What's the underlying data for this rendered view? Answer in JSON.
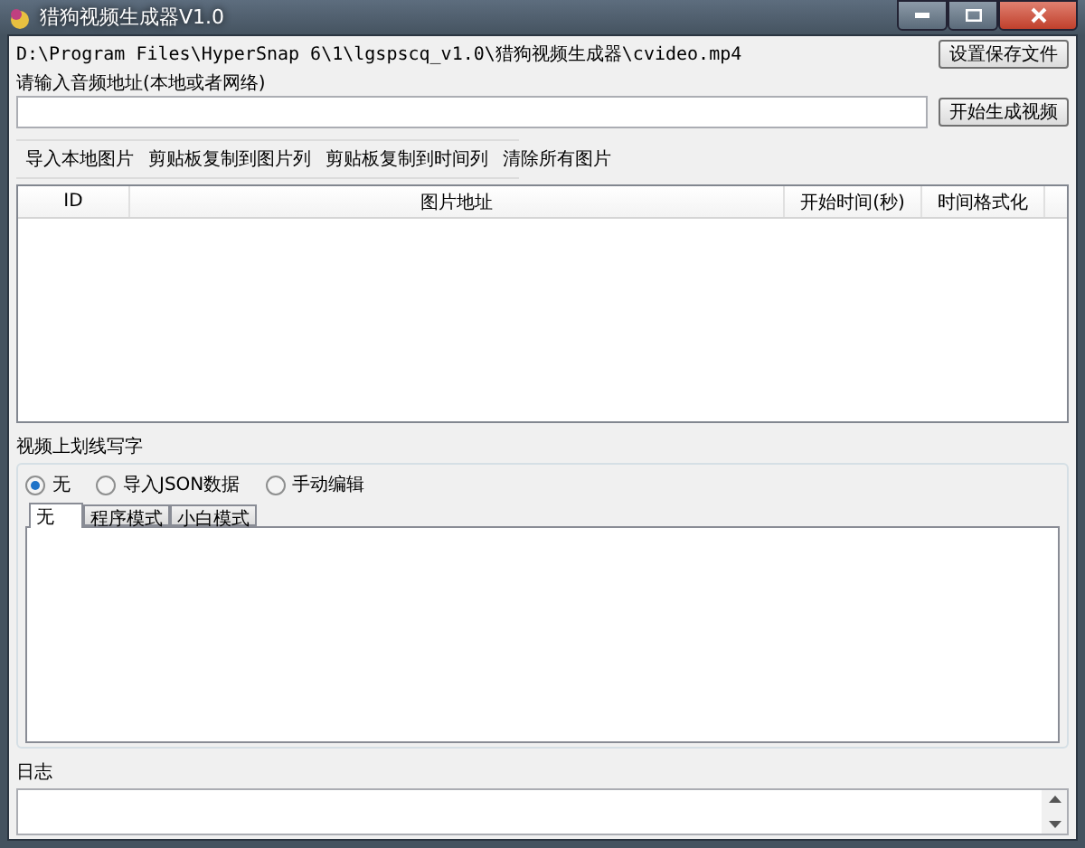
{
  "window": {
    "title": "猎狗视频生成器V1.0"
  },
  "save_path": "D:\\Program Files\\HyperSnap 6\\1\\lgspscq_v1.0\\猎狗视频生成器\\cvideo.mp4",
  "save_button": "设置保存文件",
  "audio_label": "请输入音频地址(本地或者网络)",
  "generate_button": "开始生成视频",
  "toolbar": [
    "导入本地图片",
    "剪贴板复制到图片列",
    "剪贴板复制到时间列",
    "清除所有图片"
  ],
  "table": {
    "columns": [
      "ID",
      "图片地址",
      "开始时间(秒)",
      "时间格式化"
    ]
  },
  "overlay_group": {
    "title": "视频上划线写字",
    "radios": [
      {
        "label": "无",
        "selected": true
      },
      {
        "label": "导入JSON数据",
        "selected": false
      },
      {
        "label": "手动编辑",
        "selected": false
      }
    ],
    "tabs": [
      {
        "label": "无",
        "selected": true
      },
      {
        "label": "程序模式",
        "selected": false
      },
      {
        "label": "小白模式",
        "selected": false
      }
    ]
  },
  "log": {
    "title": "日志"
  }
}
